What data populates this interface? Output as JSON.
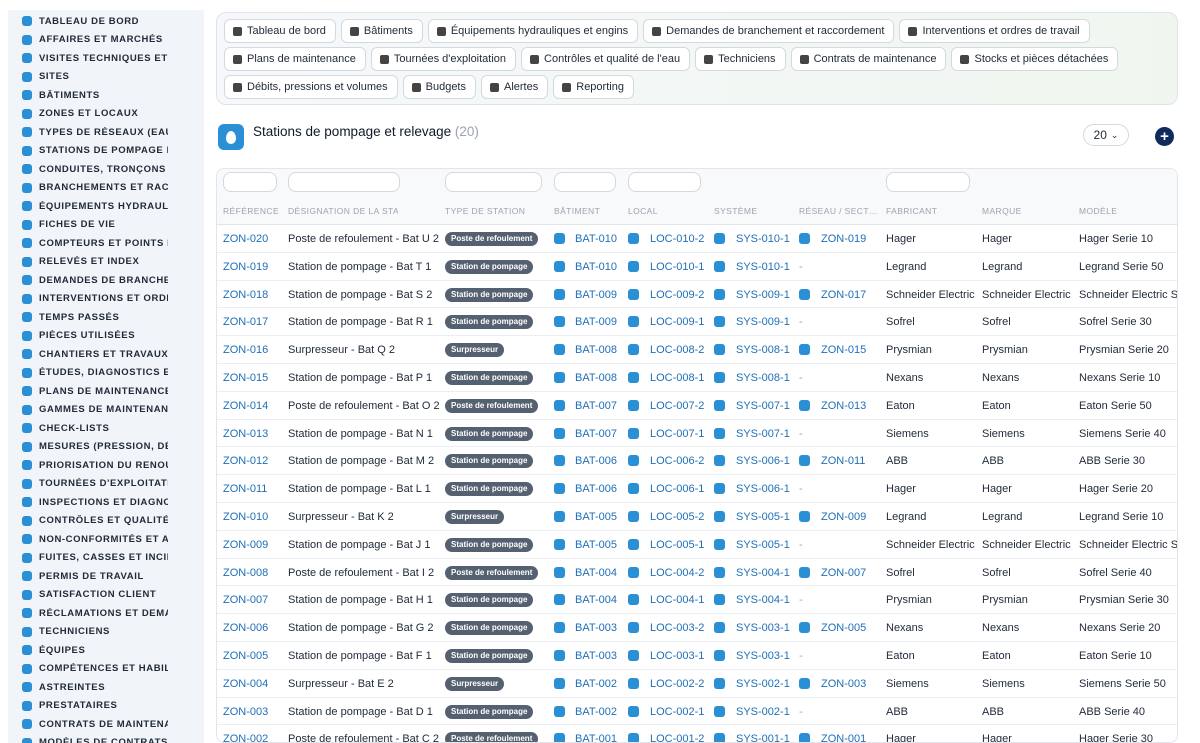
{
  "sidebar": {
    "items": [
      {
        "label": "TABLEAU DE BORD"
      },
      {
        "label": "AFFAIRES ET MARCHÉS"
      },
      {
        "label": "VISITES TECHNIQUES ET"
      },
      {
        "label": "SITES"
      },
      {
        "label": "BÂTIMENTS"
      },
      {
        "label": "ZONES ET LOCAUX"
      },
      {
        "label": "TYPES DE RÉSEAUX (EAU"
      },
      {
        "label": "STATIONS DE POMPAGE E"
      },
      {
        "label": "CONDUITES, TRONÇONS"
      },
      {
        "label": "BRANCHEMENTS ET RAC"
      },
      {
        "label": "ÉQUIPEMENTS HYDRAUL"
      },
      {
        "label": "FICHES DE VIE"
      },
      {
        "label": "COMPTEURS ET POINTS I"
      },
      {
        "label": "RELEVÉS ET INDEX"
      },
      {
        "label": "DEMANDES DE BRANCHE"
      },
      {
        "label": "INTERVENTIONS ET ORDI"
      },
      {
        "label": "TEMPS PASSÉS"
      },
      {
        "label": "PIÈCES UTILISÉES"
      },
      {
        "label": "CHANTIERS ET TRAVAUX"
      },
      {
        "label": "ÉTUDES, DIAGNOSTICS E"
      },
      {
        "label": "PLANS DE MAINTENANCE"
      },
      {
        "label": "GAMMES DE MAINTENAN"
      },
      {
        "label": "CHECK-LISTS"
      },
      {
        "label": "MESURES (PRESSION, DÉ"
      },
      {
        "label": "PRIORISATION DU RENOU"
      },
      {
        "label": "TOURNÉES D'EXPLOITATI"
      },
      {
        "label": "INSPECTIONS ET DIAGNC"
      },
      {
        "label": "CONTRÔLES ET QUALITÉ"
      },
      {
        "label": "NON-CONFORMITÉS ET A"
      },
      {
        "label": "FUITES, CASSES ET INCII"
      },
      {
        "label": "PERMIS DE TRAVAIL"
      },
      {
        "label": "SATISFACTION CLIENT"
      },
      {
        "label": "RÉCLAMATIONS ET DEMA"
      },
      {
        "label": "TECHNICIENS"
      },
      {
        "label": "ÉQUIPES"
      },
      {
        "label": "COMPÉTENCES ET HABIL"
      },
      {
        "label": "ASTREINTES"
      },
      {
        "label": "PRESTATAIRES"
      },
      {
        "label": "CONTRATS DE MAINTENA"
      },
      {
        "label": "MODÈLES DE CONTRATS"
      }
    ]
  },
  "nav": {
    "pills": [
      {
        "label": "Tableau de bord",
        "icon": "gauge-icon"
      },
      {
        "label": "Bâtiments",
        "icon": "building-icon"
      },
      {
        "label": "Équipements hydrauliques et engins",
        "icon": "cogs-icon"
      },
      {
        "label": "Demandes de branchement et raccordement",
        "icon": "question-icon"
      },
      {
        "label": "Interventions et ordres de travail",
        "icon": "clipboard-icon"
      },
      {
        "label": "Plans de maintenance",
        "icon": "calendar-icon"
      },
      {
        "label": "Tournées d'exploitation",
        "icon": "route-icon"
      },
      {
        "label": "Contrôles et qualité de l'eau",
        "icon": "clipboard-check-icon"
      },
      {
        "label": "Techniciens",
        "icon": "hardhat-icon"
      },
      {
        "label": "Contrats de maintenance",
        "icon": "file-contract-icon"
      },
      {
        "label": "Stocks et pièces détachées",
        "icon": "boxes-icon"
      },
      {
        "label": "Débits, pressions et volumes",
        "icon": "bolt-icon"
      },
      {
        "label": "Budgets",
        "icon": "money-icon"
      },
      {
        "label": "Alertes",
        "icon": "bell-icon"
      },
      {
        "label": "Reporting",
        "icon": "chart-pie-icon"
      }
    ]
  },
  "page": {
    "title": "Stations de pompage et relevage",
    "count": "(20)",
    "per_page": "20",
    "add": "+",
    "logo_icon": "water-drop-icon"
  },
  "columns": [
    "RÉFÉRENCE",
    "DÉSIGNATION DE LA STATION",
    "TYPE DE STATION",
    "BÂTIMENT",
    "LOCAL",
    "SYSTÈME",
    "RÉSEAU / SECT…",
    "FABRICANT",
    "MARQUE",
    "MODÈLE"
  ],
  "rows": [
    {
      "ref": "ZON-020",
      "name": "Poste de refoulement - Bat U 2",
      "type": "Poste de refoulement",
      "bat": "BAT-010",
      "loc": "LOC-010-2",
      "sys": "SYS-010-1",
      "net": "ZON-019",
      "fab": "Hager",
      "brand": "Hager",
      "model": "Hager Serie 10"
    },
    {
      "ref": "ZON-019",
      "name": "Station de pompage - Bat T 1",
      "type": "Station de pompage",
      "bat": "BAT-010",
      "loc": "LOC-010-1",
      "sys": "SYS-010-1",
      "net": "-",
      "fab": "Legrand",
      "brand": "Legrand",
      "model": "Legrand Serie 50"
    },
    {
      "ref": "ZON-018",
      "name": "Station de pompage - Bat S 2",
      "type": "Station de pompage",
      "bat": "BAT-009",
      "loc": "LOC-009-2",
      "sys": "SYS-009-1",
      "net": "ZON-017",
      "fab": "Schneider Electric",
      "brand": "Schneider Electric",
      "model": "Schneider Electric Se"
    },
    {
      "ref": "ZON-017",
      "name": "Station de pompage - Bat R 1",
      "type": "Station de pompage",
      "bat": "BAT-009",
      "loc": "LOC-009-1",
      "sys": "SYS-009-1",
      "net": "-",
      "fab": "Sofrel",
      "brand": "Sofrel",
      "model": "Sofrel Serie 30"
    },
    {
      "ref": "ZON-016",
      "name": "Surpresseur - Bat Q 2",
      "type": "Surpresseur",
      "bat": "BAT-008",
      "loc": "LOC-008-2",
      "sys": "SYS-008-1",
      "net": "ZON-015",
      "fab": "Prysmian",
      "brand": "Prysmian",
      "model": "Prysmian Serie 20"
    },
    {
      "ref": "ZON-015",
      "name": "Station de pompage - Bat P 1",
      "type": "Station de pompage",
      "bat": "BAT-008",
      "loc": "LOC-008-1",
      "sys": "SYS-008-1",
      "net": "-",
      "fab": "Nexans",
      "brand": "Nexans",
      "model": "Nexans Serie 10"
    },
    {
      "ref": "ZON-014",
      "name": "Poste de refoulement - Bat O 2",
      "type": "Poste de refoulement",
      "bat": "BAT-007",
      "loc": "LOC-007-2",
      "sys": "SYS-007-1",
      "net": "ZON-013",
      "fab": "Eaton",
      "brand": "Eaton",
      "model": "Eaton Serie 50"
    },
    {
      "ref": "ZON-013",
      "name": "Station de pompage - Bat N 1",
      "type": "Station de pompage",
      "bat": "BAT-007",
      "loc": "LOC-007-1",
      "sys": "SYS-007-1",
      "net": "-",
      "fab": "Siemens",
      "brand": "Siemens",
      "model": "Siemens Serie 40"
    },
    {
      "ref": "ZON-012",
      "name": "Station de pompage - Bat M 2",
      "type": "Station de pompage",
      "bat": "BAT-006",
      "loc": "LOC-006-2",
      "sys": "SYS-006-1",
      "net": "ZON-011",
      "fab": "ABB",
      "brand": "ABB",
      "model": "ABB Serie 30"
    },
    {
      "ref": "ZON-011",
      "name": "Station de pompage - Bat L 1",
      "type": "Station de pompage",
      "bat": "BAT-006",
      "loc": "LOC-006-1",
      "sys": "SYS-006-1",
      "net": "-",
      "fab": "Hager",
      "brand": "Hager",
      "model": "Hager Serie 20"
    },
    {
      "ref": "ZON-010",
      "name": "Surpresseur - Bat K 2",
      "type": "Surpresseur",
      "bat": "BAT-005",
      "loc": "LOC-005-2",
      "sys": "SYS-005-1",
      "net": "ZON-009",
      "fab": "Legrand",
      "brand": "Legrand",
      "model": "Legrand Serie 10"
    },
    {
      "ref": "ZON-009",
      "name": "Station de pompage - Bat J 1",
      "type": "Station de pompage",
      "bat": "BAT-005",
      "loc": "LOC-005-1",
      "sys": "SYS-005-1",
      "net": "-",
      "fab": "Schneider Electric",
      "brand": "Schneider Electric",
      "model": "Schneider Electric Se"
    },
    {
      "ref": "ZON-008",
      "name": "Poste de refoulement - Bat I 2",
      "type": "Poste de refoulement",
      "bat": "BAT-004",
      "loc": "LOC-004-2",
      "sys": "SYS-004-1",
      "net": "ZON-007",
      "fab": "Sofrel",
      "brand": "Sofrel",
      "model": "Sofrel Serie 40"
    },
    {
      "ref": "ZON-007",
      "name": "Station de pompage - Bat H 1",
      "type": "Station de pompage",
      "bat": "BAT-004",
      "loc": "LOC-004-1",
      "sys": "SYS-004-1",
      "net": "-",
      "fab": "Prysmian",
      "brand": "Prysmian",
      "model": "Prysmian Serie 30"
    },
    {
      "ref": "ZON-006",
      "name": "Station de pompage - Bat G 2",
      "type": "Station de pompage",
      "bat": "BAT-003",
      "loc": "LOC-003-2",
      "sys": "SYS-003-1",
      "net": "ZON-005",
      "fab": "Nexans",
      "brand": "Nexans",
      "model": "Nexans Serie 20"
    },
    {
      "ref": "ZON-005",
      "name": "Station de pompage - Bat F 1",
      "type": "Station de pompage",
      "bat": "BAT-003",
      "loc": "LOC-003-1",
      "sys": "SYS-003-1",
      "net": "-",
      "fab": "Eaton",
      "brand": "Eaton",
      "model": "Eaton Serie 10"
    },
    {
      "ref": "ZON-004",
      "name": "Surpresseur - Bat E 2",
      "type": "Surpresseur",
      "bat": "BAT-002",
      "loc": "LOC-002-2",
      "sys": "SYS-002-1",
      "net": "ZON-003",
      "fab": "Siemens",
      "brand": "Siemens",
      "model": "Siemens Serie 50"
    },
    {
      "ref": "ZON-003",
      "name": "Station de pompage - Bat D 1",
      "type": "Station de pompage",
      "bat": "BAT-002",
      "loc": "LOC-002-1",
      "sys": "SYS-002-1",
      "net": "-",
      "fab": "ABB",
      "brand": "ABB",
      "model": "ABB Serie 40"
    },
    {
      "ref": "ZON-002",
      "name": "Poste de refoulement - Bat C 2",
      "type": "Poste de refoulement",
      "bat": "BAT-001",
      "loc": "LOC-001-2",
      "sys": "SYS-001-1",
      "net": "ZON-001",
      "fab": "Hager",
      "brand": "Hager",
      "model": "Hager Serie 30"
    }
  ],
  "colors": {
    "accent": "#2b8fd6",
    "link": "#1f6fb8",
    "badge": "#556170",
    "add_button": "#0f2b5b"
  }
}
